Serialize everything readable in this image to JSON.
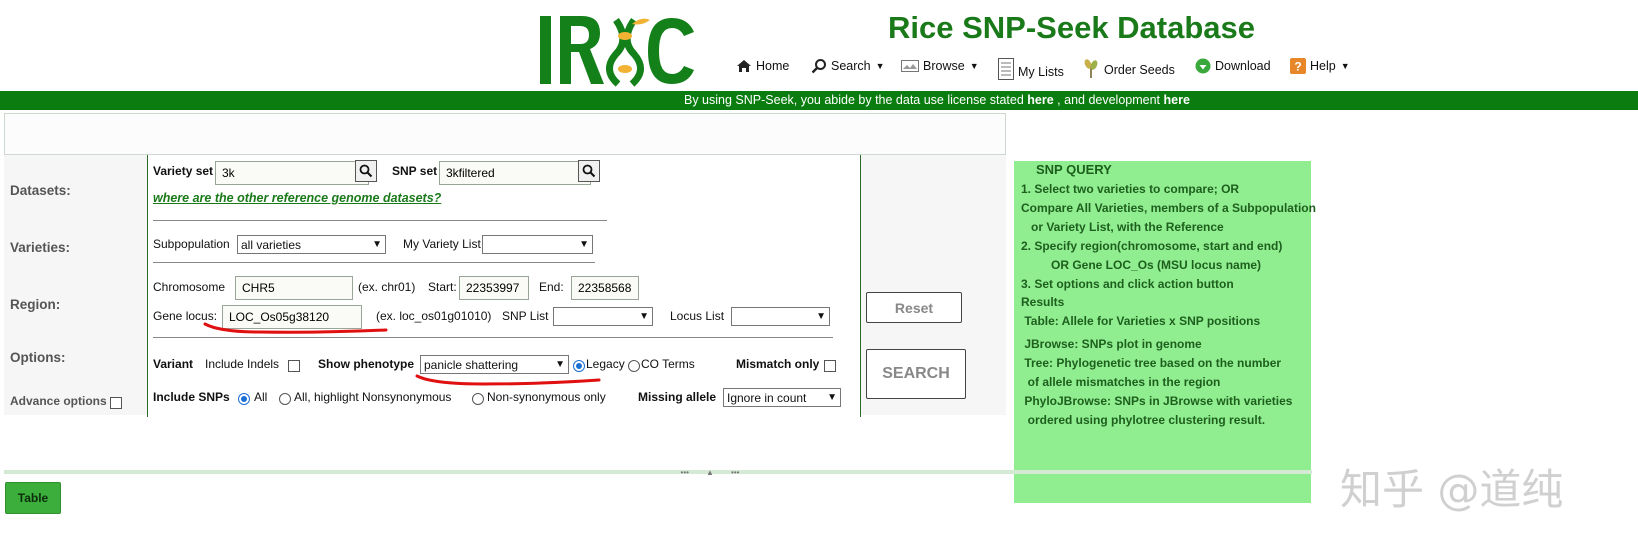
{
  "header": {
    "logo_text": "IRIC",
    "title": "Rice SNP-Seek Database",
    "nav": [
      {
        "label": "Home",
        "icon": "home-icon"
      },
      {
        "label": "Search",
        "icon": "search-icon",
        "dropdown": true
      },
      {
        "label": "Browse",
        "icon": "browse-icon",
        "dropdown": true
      },
      {
        "label": "My Lists",
        "icon": "list-icon"
      },
      {
        "label": "Order Seeds",
        "icon": "seeds-icon"
      },
      {
        "label": "Download",
        "icon": "download-icon"
      },
      {
        "label": "Help",
        "icon": "help-icon",
        "dropdown": true
      }
    ]
  },
  "banner": {
    "text_before": "By using SNP-Seek, you abide by the data use license stated",
    "link1": "here",
    "text_middle": ", and development",
    "link2": "here"
  },
  "form": {
    "row_labels": {
      "datasets": "Datasets:",
      "varieties": "Varieties:",
      "region": "Region:",
      "options": "Options:",
      "advance": "Advance options"
    },
    "variety_set": {
      "label": "Variety set",
      "value": "3k"
    },
    "snp_set": {
      "label": "SNP set",
      "value": "3kfiltered"
    },
    "other_datasets_link": "where are the other reference genome datasets?",
    "subpopulation": {
      "label": "Subpopulation",
      "value": "all varieties"
    },
    "my_variety_list": {
      "label": "My Variety List",
      "value": ""
    },
    "chromosome": {
      "label": "Chromosome",
      "value": "CHR5",
      "hint": "(ex. chr01)"
    },
    "start": {
      "label": "Start:",
      "value": "22353997"
    },
    "end": {
      "label": "End:",
      "value": "22358568"
    },
    "gene_locus": {
      "label": "Gene locus:",
      "value": "LOC_Os05g38120",
      "hint": "(ex. loc_os01g01010)"
    },
    "snp_list": {
      "label": "SNP List",
      "value": ""
    },
    "locus_list": {
      "label": "Locus List",
      "value": ""
    },
    "variant_label": "Variant",
    "include_indels": "Include Indels",
    "show_phenotype": {
      "label": "Show phenotype",
      "value": "panicle shattering"
    },
    "phenotype_radios": [
      "Legacy",
      "CO Terms"
    ],
    "mismatch_only": "Mismatch only",
    "include_snps": {
      "label": "Include SNPs",
      "options": [
        "All",
        "All, highlight Nonsynonymous",
        "Non-synonymous only"
      ]
    },
    "missing_allele": {
      "label": "Missing allele",
      "value": "Ignore in count"
    },
    "reset_label": "Reset",
    "search_label": "SEARCH"
  },
  "help": {
    "title": "SNP QUERY",
    "lines": [
      "1. Select two varieties to compare; OR",
      "Compare All Varieties, members of a Subpopulation",
      "   or Variety List, with the Reference",
      "2. Specify region(chromosome, start and end)",
      "         OR Gene LOC_Os (MSU locus name)",
      "3. Set options and click action button",
      "Results",
      " Table: Allele for Varieties x SNP positions",
      " JBrowse: SNPs plot in genome",
      " Tree: Phylogenetic tree based on the number",
      "  of allele mismatches in the region",
      " PhyloJBrowse: SNPs in JBrowse with varieties",
      "  ordered using phylotree clustering result."
    ]
  },
  "bottom": {
    "table_tab": "Table"
  },
  "watermark": "知乎 @道纯",
  "colors": {
    "brand_green": "#1a7a1a",
    "banner_green": "#0a7c10",
    "help_bg": "#90ee90",
    "annotation_red": "#e01010"
  }
}
